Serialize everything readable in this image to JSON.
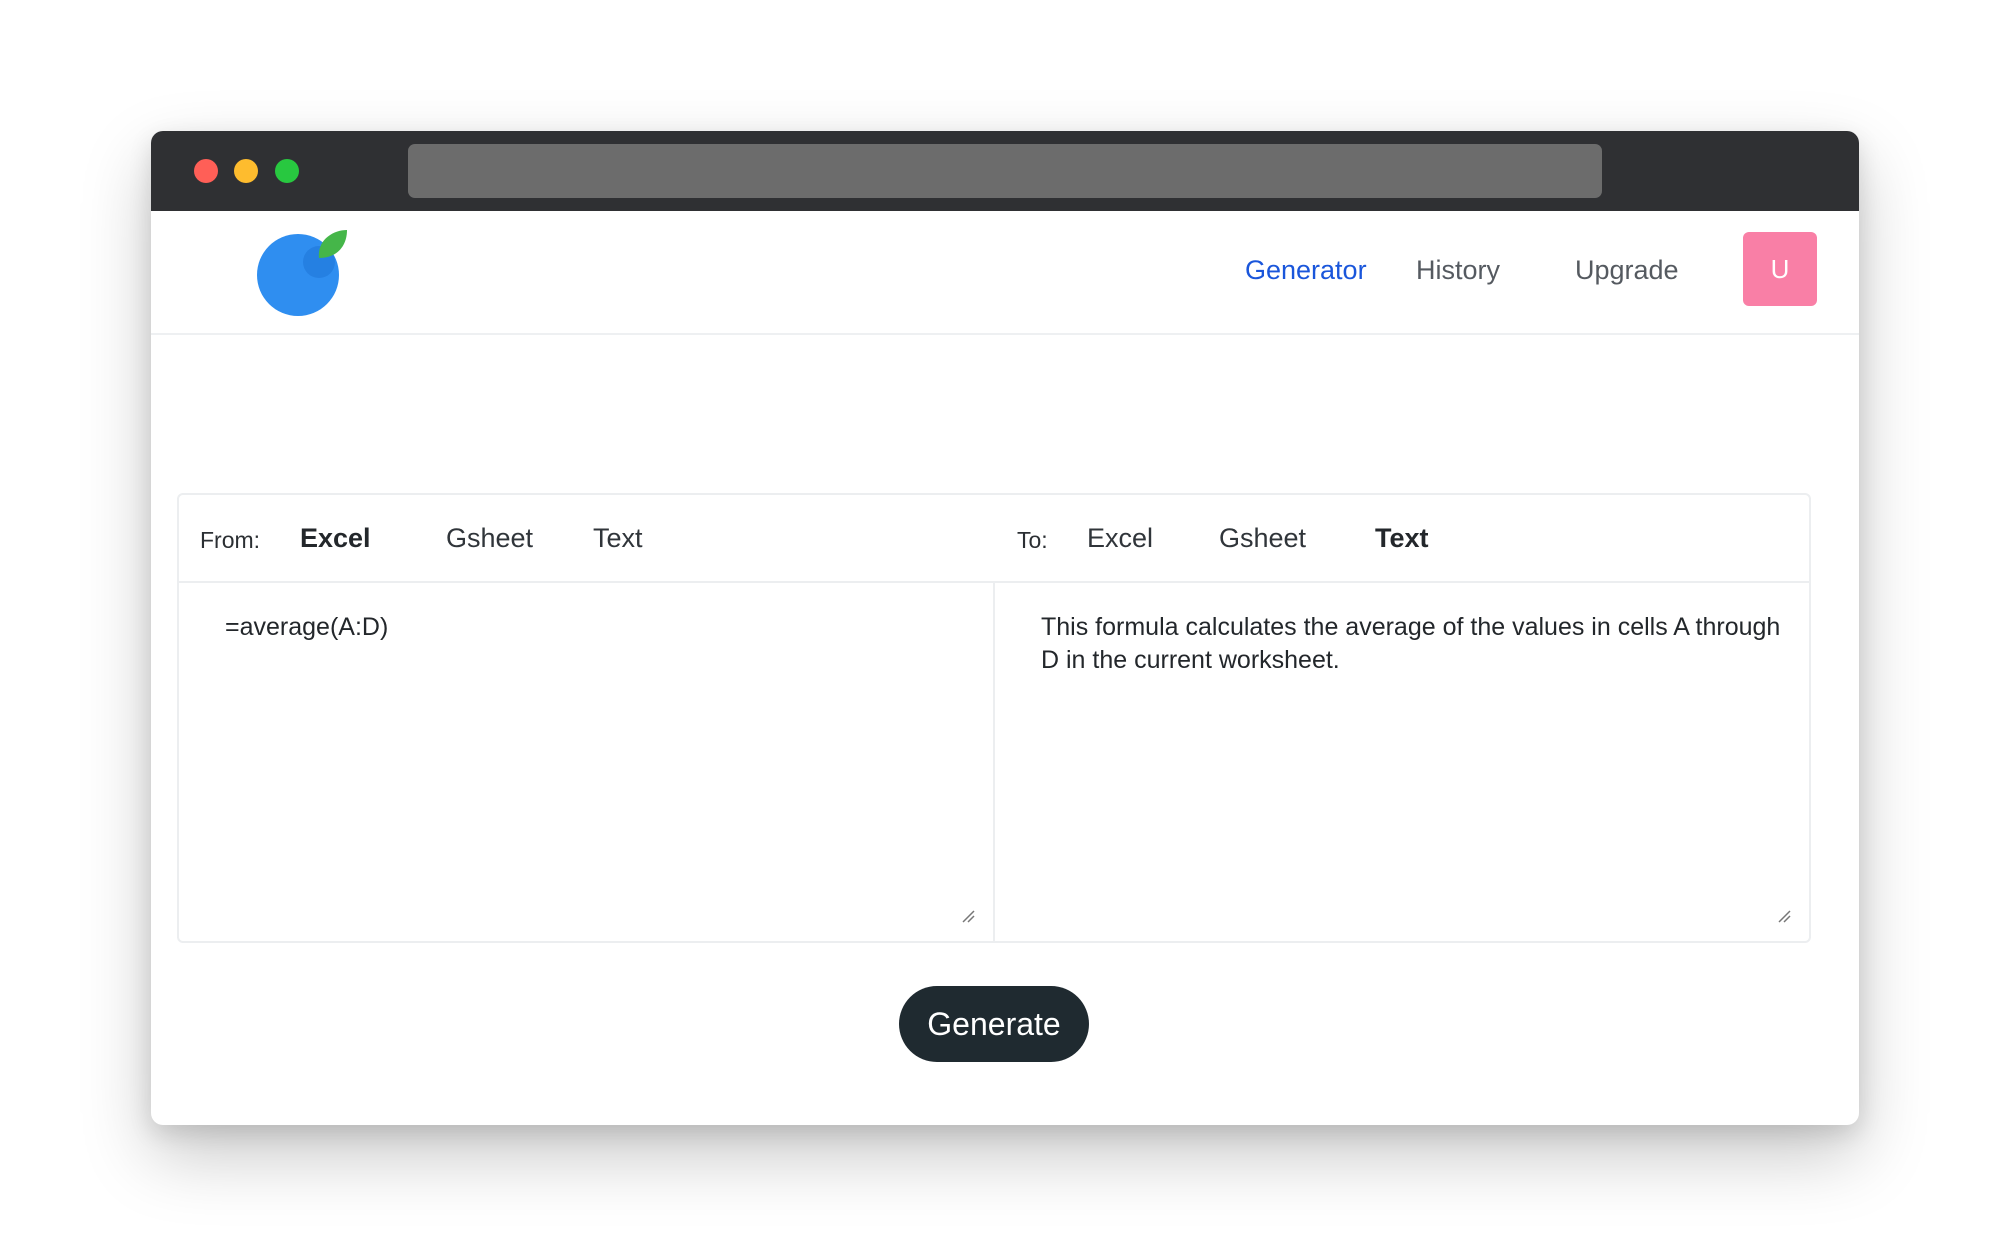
{
  "colors": {
    "titlebar": "#2f3033",
    "traffic_red": "#ff5f57",
    "traffic_yellow": "#febc2e",
    "traffic_green": "#28c840",
    "accent": "#1a56db",
    "avatar_bg": "#f97fa6",
    "button_bg": "#1f2a30",
    "logo_blue": "#2f8ef0",
    "logo_leaf": "#45b649"
  },
  "nav": {
    "items": [
      {
        "label": "Generator",
        "active": true
      },
      {
        "label": "History",
        "active": false
      },
      {
        "label": "Upgrade",
        "active": false
      }
    ],
    "avatar_letter": "U"
  },
  "converter": {
    "from_label": "From:",
    "to_label": "To:",
    "from_options": [
      "Excel",
      "Gsheet",
      "Text"
    ],
    "from_selected": "Excel",
    "to_options": [
      "Excel",
      "Gsheet",
      "Text"
    ],
    "to_selected": "Text",
    "input_text": "=average(A:D)",
    "output_text": "This formula calculates the average of the values in cells A through D in the current worksheet."
  },
  "actions": {
    "generate_label": "Generate"
  }
}
